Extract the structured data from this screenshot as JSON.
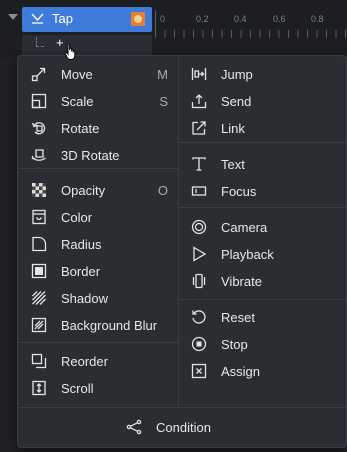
{
  "timeline": {
    "trigger_label": "Tap",
    "add_symbol": "+",
    "ruler_ticks": [
      "0",
      "0.2",
      "0.4",
      "0.6",
      "0.8"
    ]
  },
  "menu": {
    "left": [
      {
        "label": "Move",
        "shortcut": "M",
        "icon": "move-icon"
      },
      {
        "label": "Scale",
        "shortcut": "S",
        "icon": "scale-icon"
      },
      {
        "label": "Rotate",
        "shortcut": "",
        "icon": "rotate-icon"
      },
      {
        "label": "3D Rotate",
        "shortcut": "",
        "icon": "3d-rotate-icon"
      },
      {
        "label": "Opacity",
        "shortcut": "O",
        "icon": "opacity-icon"
      },
      {
        "label": "Color",
        "shortcut": "",
        "icon": "color-icon"
      },
      {
        "label": "Radius",
        "shortcut": "",
        "icon": "radius-icon"
      },
      {
        "label": "Border",
        "shortcut": "",
        "icon": "border-icon"
      },
      {
        "label": "Shadow",
        "shortcut": "",
        "icon": "shadow-icon"
      },
      {
        "label": "Background Blur",
        "shortcut": "",
        "icon": "background-blur-icon"
      },
      {
        "label": "Reorder",
        "shortcut": "",
        "icon": "reorder-icon"
      },
      {
        "label": "Scroll",
        "shortcut": "",
        "icon": "scroll-icon"
      }
    ],
    "right": [
      {
        "label": "Jump",
        "icon": "jump-icon"
      },
      {
        "label": "Send",
        "icon": "send-icon"
      },
      {
        "label": "Link",
        "icon": "link-icon"
      },
      {
        "label": "Text",
        "icon": "text-icon"
      },
      {
        "label": "Focus",
        "icon": "focus-icon"
      },
      {
        "label": "Camera",
        "icon": "camera-icon"
      },
      {
        "label": "Playback",
        "icon": "playback-icon"
      },
      {
        "label": "Vibrate",
        "icon": "vibrate-icon"
      },
      {
        "label": "Reset",
        "icon": "reset-icon"
      },
      {
        "label": "Stop",
        "icon": "stop-icon"
      },
      {
        "label": "Assign",
        "icon": "assign-icon"
      }
    ],
    "condition_label": "Condition"
  },
  "colors": {
    "accent": "#3f7bdb",
    "menu_bg": "#2a2d32",
    "page_bg": "#1f2125"
  }
}
